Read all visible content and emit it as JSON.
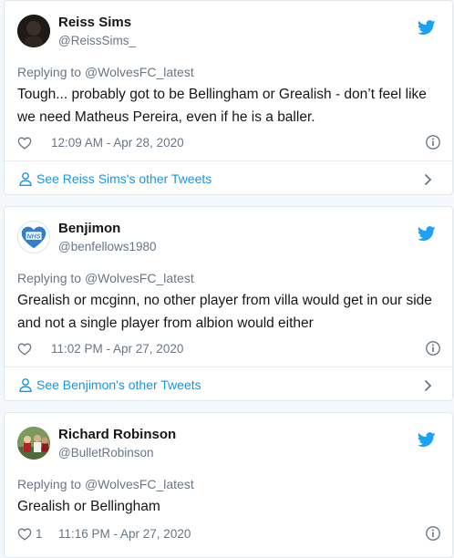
{
  "colors": {
    "accent": "#1da1f2",
    "link": "#1b95e0",
    "muted": "#657786"
  },
  "tweets": [
    {
      "name": "Reiss Sims",
      "handle": "@ReissSims_",
      "replying_prefix": "Replying to ",
      "replying_to": "@WolvesFC_latest",
      "text": "Tough... probably got to be Bellingham or Grealish - don’t feel like we need Matheus Pereira, even if he is a baller.",
      "likes": "",
      "timestamp": "12:09 AM - Apr 28, 2020",
      "footer_link": "See Reiss Sims's other Tweets",
      "avatar_icon": "dark-photo-avatar"
    },
    {
      "name": "Benjimon",
      "handle": "@benfellows1980",
      "replying_prefix": "Replying to ",
      "replying_to": "@WolvesFC_latest",
      "text": "Grealish or mcginn, no other player from villa would get in our side and not a single player from albion would either",
      "likes": "",
      "timestamp": "11:02 PM - Apr 27, 2020",
      "footer_link": "See Benjimon's other Tweets",
      "avatar_icon": "nhs-heart-avatar",
      "avatar_text": "NHS"
    },
    {
      "name": "Richard Robinson",
      "handle": "@BulletRobinson",
      "replying_prefix": "Replying to ",
      "replying_to": "@WolvesFC_latest",
      "text": "Grealish or Bellingham",
      "likes": "1",
      "timestamp": "11:16 PM - Apr 27, 2020",
      "avatar_icon": "group-photo-avatar"
    }
  ]
}
